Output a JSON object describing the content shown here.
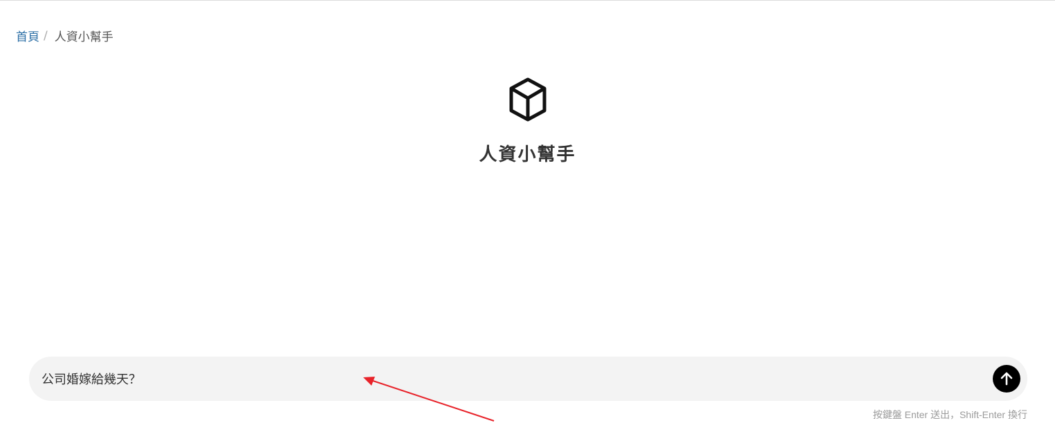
{
  "breadcrumb": {
    "home_label": "首頁",
    "separator": "/",
    "current_label": "人資小幫手"
  },
  "hero": {
    "icon": "cube-icon",
    "title": "人資小幫手"
  },
  "chat": {
    "input_value": "公司婚嫁給幾天？",
    "send_icon": "arrow-up-icon",
    "hint": "按鍵盤 Enter 送出，Shift-Enter 換行"
  },
  "colors": {
    "link": "#2c6fa6",
    "input_background": "#f3f3f3",
    "send_button": "#000000",
    "annotation_arrow": "#e8232a"
  }
}
